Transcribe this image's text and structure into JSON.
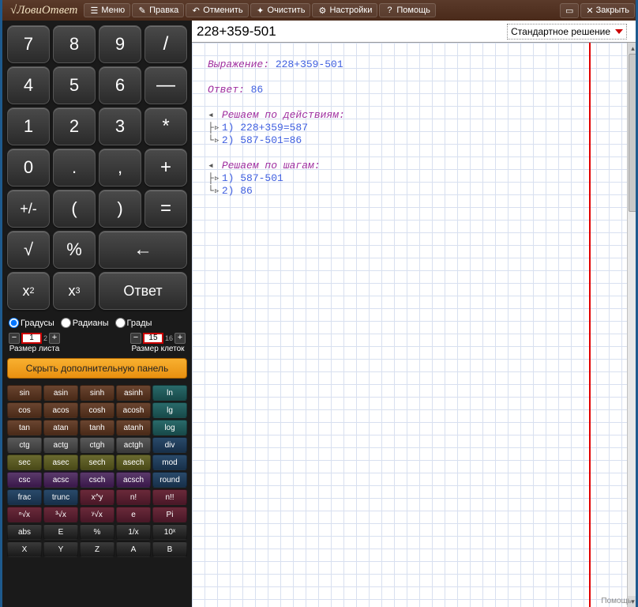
{
  "app": {
    "title": "ЛовиОтвет"
  },
  "toolbar": {
    "menu": "Меню",
    "edit": "Правка",
    "undo": "Отменить",
    "clear": "Очистить",
    "settings": "Настройки",
    "help": "Помощь",
    "close": "Закрыть"
  },
  "keypad": {
    "k7": "7",
    "k8": "8",
    "k9": "9",
    "div": "/",
    "k4": "4",
    "k5": "5",
    "k6": "6",
    "minus": "—",
    "k1": "1",
    "k2": "2",
    "k3": "3",
    "mul": "*",
    "k0": "0",
    "dot": ".",
    "comma": ",",
    "plus": "+",
    "pm": "+/-",
    "lp": "(",
    "rp": ")",
    "eq": "=",
    "sqrt": "√",
    "pct": "%",
    "back": "←",
    "x2_base": "x",
    "x2_sup": "2",
    "x3_base": "x",
    "x3_sup": "3",
    "answer": "Ответ"
  },
  "angle": {
    "deg": "Градусы",
    "rad": "Радианы",
    "grad": "Грады",
    "selected": "deg"
  },
  "size": {
    "sheet_label": "Размер листа",
    "sheet_val": "1",
    "sheet_max": "2",
    "cell_label": "Размер клеток",
    "cell_val": "15",
    "cell_max": "16"
  },
  "toggle_panel": "Скрыть дополнительную панель",
  "fn": {
    "rows": [
      [
        {
          "t": "sin",
          "c": "brown"
        },
        {
          "t": "asin",
          "c": "brown"
        },
        {
          "t": "sinh",
          "c": "brown"
        },
        {
          "t": "asinh",
          "c": "brown"
        },
        {
          "t": "ln",
          "c": "teal"
        }
      ],
      [
        {
          "t": "cos",
          "c": "brown"
        },
        {
          "t": "acos",
          "c": "brown"
        },
        {
          "t": "cosh",
          "c": "brown"
        },
        {
          "t": "acosh",
          "c": "brown"
        },
        {
          "t": "lg",
          "c": "teal"
        }
      ],
      [
        {
          "t": "tan",
          "c": "brown"
        },
        {
          "t": "atan",
          "c": "brown"
        },
        {
          "t": "tanh",
          "c": "brown"
        },
        {
          "t": "atanh",
          "c": "brown"
        },
        {
          "t": "log",
          "c": "teal"
        }
      ],
      [
        {
          "t": "ctg",
          "c": "gray"
        },
        {
          "t": "actg",
          "c": "gray"
        },
        {
          "t": "ctgh",
          "c": "gray"
        },
        {
          "t": "actgh",
          "c": "gray"
        },
        {
          "t": "div",
          "c": "navy"
        }
      ],
      [
        {
          "t": "sec",
          "c": "olive"
        },
        {
          "t": "asec",
          "c": "olive"
        },
        {
          "t": "sech",
          "c": "olive"
        },
        {
          "t": "asech",
          "c": "olive"
        },
        {
          "t": "mod",
          "c": "navy"
        }
      ],
      [
        {
          "t": "csc",
          "c": "purple"
        },
        {
          "t": "acsc",
          "c": "purple"
        },
        {
          "t": "csch",
          "c": "purple"
        },
        {
          "t": "acsch",
          "c": "purple"
        },
        {
          "t": "round",
          "c": "navy"
        }
      ],
      [
        {
          "t": "frac",
          "c": "navy"
        },
        {
          "t": "trunc",
          "c": "navy"
        },
        {
          "t": "x^y",
          "c": "maroon"
        },
        {
          "t": "n!",
          "c": "maroon"
        },
        {
          "t": "n!!",
          "c": "maroon"
        }
      ],
      [
        {
          "t": "ⁿ√x",
          "c": "maroon"
        },
        {
          "t": "³√x",
          "c": "maroon"
        },
        {
          "t": "ʸ√x",
          "c": "maroon"
        },
        {
          "t": "e",
          "c": "maroon"
        },
        {
          "t": "Pi",
          "c": "maroon"
        }
      ],
      [
        {
          "t": "abs",
          "c": "dark"
        },
        {
          "t": "E",
          "c": "dark"
        },
        {
          "t": "%",
          "c": "dark"
        },
        {
          "t": "1/x",
          "c": "dark"
        },
        {
          "t": "10ˣ",
          "c": "dark"
        }
      ],
      [
        {
          "t": "X",
          "c": "dark"
        },
        {
          "t": "Y",
          "c": "dark"
        },
        {
          "t": "Z",
          "c": "dark"
        },
        {
          "t": "A",
          "c": "dark"
        },
        {
          "t": "B",
          "c": "dark"
        }
      ]
    ]
  },
  "expression": "228+359-501",
  "solution_type": "Стандартное решение",
  "paper": {
    "expr_label": "Выражение:",
    "expr_val": "228+359-501",
    "ans_label": "Ответ:",
    "ans_val": "86",
    "by_actions": "Решаем по действиям:",
    "act1": "1) 228+359=587",
    "act2": "2) 587-501=86",
    "by_steps": "Решаем по шагам:",
    "step1": "1) 587-501",
    "step2": "2) 86",
    "red_margin_x": 503,
    "footer_help": "Помощь"
  }
}
